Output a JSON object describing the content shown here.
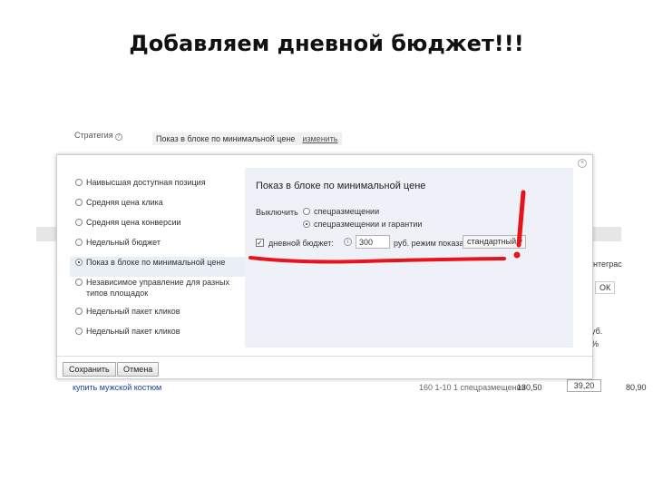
{
  "slide_title": "Добавляем дневной бюджет!!!",
  "background": {
    "strategy_label": "Стратегия",
    "strategy_value": "Показ в блоке по минимальной цене",
    "change_link": "изменить",
    "right_cut_1": "нтеграс",
    "right_cut_2": "ОК",
    "right_cut_3": "уб.",
    "right_cut_4": "%",
    "row_keyword": "купить мужской костюм",
    "row_value": "160 1-10 1 спецразмещения",
    "row_price": "130,50",
    "row_box": "39,20",
    "row_price2": "80,90"
  },
  "modal": {
    "close_glyph": "×",
    "strategies": [
      {
        "label": "Наивысшая доступная позиция",
        "selected": false
      },
      {
        "label": "Средняя цена клика",
        "selected": false
      },
      {
        "label": "Средняя цена конверсии",
        "selected": false
      },
      {
        "label": "Недельный бюджет",
        "selected": false
      },
      {
        "label": "Показ в блоке по минимальной цене",
        "selected": true
      },
      {
        "label": "Независимое управление для разных типов площадок",
        "selected": false
      },
      {
        "label": "Недельный пакет кликов",
        "selected": false
      },
      {
        "label": "Недельный пакет кликов",
        "selected": false
      }
    ],
    "panel": {
      "title": "Показ в блоке по минимальной цене",
      "show_label": "Выключить",
      "place_option_1": "спецразмещении",
      "place_option_2": "спецразмещении и гарантии",
      "budget_check": "✓",
      "budget_label": "дневной бюджет:",
      "info_glyph": "i",
      "budget_value": "300",
      "budget_unit": "руб. режим показа",
      "mode_value": "стандартный",
      "chevron": "▾"
    },
    "save_label": "Сохранить",
    "cancel_label": "Отмена"
  },
  "annotation": {
    "exclamation": "!",
    "color": "#e8141b"
  }
}
